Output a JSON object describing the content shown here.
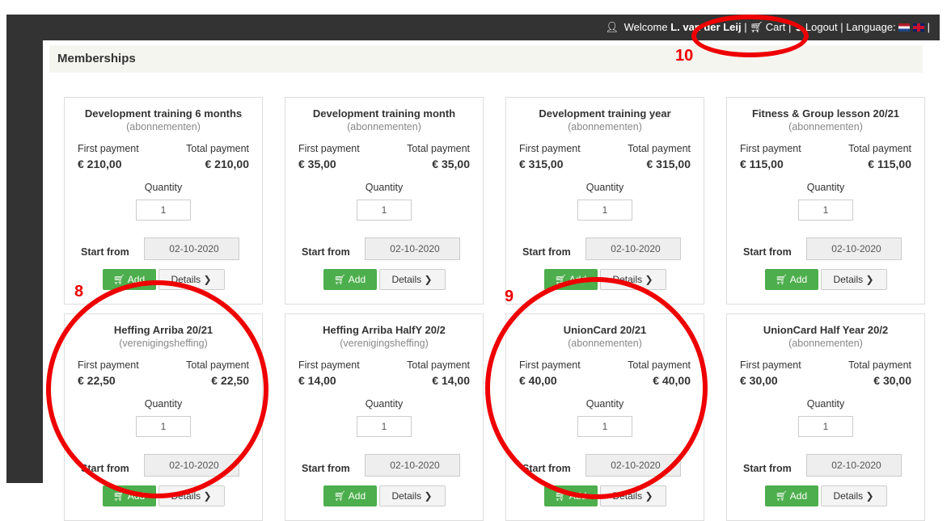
{
  "topbar": {
    "welcome": "Welcome",
    "user": "L. van der Leij",
    "sep1": "|",
    "cart": "Cart",
    "sep2": "|",
    "logout": "Logout",
    "sep3": "|",
    "language": "Language:",
    "sep4": "|"
  },
  "section": {
    "title": "Memberships"
  },
  "labels": {
    "first_payment": "First payment",
    "total_payment": "Total payment",
    "quantity": "Quantity",
    "start_from": "Start from",
    "add": "Add",
    "details": "Details"
  },
  "cards": [
    {
      "title": "Development training 6 months",
      "type": "(abonnementen)",
      "first": "€ 210,00",
      "total": "€ 210,00",
      "qty": "1",
      "start": "02-10-2020"
    },
    {
      "title": "Development training month",
      "type": "(abonnementen)",
      "first": "€ 35,00",
      "total": "€ 35,00",
      "qty": "1",
      "start": "02-10-2020"
    },
    {
      "title": "Development training year",
      "type": "(abonnementen)",
      "first": "€ 315,00",
      "total": "€ 315,00",
      "qty": "1",
      "start": "02-10-2020"
    },
    {
      "title": "Fitness & Group lesson 20/21",
      "type": "(abonnementen)",
      "first": "€ 115,00",
      "total": "€ 115,00",
      "qty": "1",
      "start": "02-10-2020"
    },
    {
      "title": "Heffing Arriba 20/21",
      "type": "(verenigingsheffing)",
      "first": "€ 22,50",
      "total": "€ 22,50",
      "qty": "1",
      "start": "02-10-2020"
    },
    {
      "title": "Heffing Arriba HalfY 20/2",
      "type": "(verenigingsheffing)",
      "first": "€ 14,00",
      "total": "€ 14,00",
      "qty": "1",
      "start": "02-10-2020"
    },
    {
      "title": "UnionCard 20/21",
      "type": "(abonnementen)",
      "first": "€ 40,00",
      "total": "€ 40,00",
      "qty": "1",
      "start": "02-10-2020"
    },
    {
      "title": "UnionCard Half Year 20/2",
      "type": "(abonnementen)",
      "first": "€ 30,00",
      "total": "€ 30,00",
      "qty": "1",
      "start": "02-10-2020"
    }
  ],
  "annotations": {
    "a8": "8",
    "a9": "9",
    "a10": "10"
  },
  "colors": {
    "add_button": "#4cae4c",
    "annotation": "#e00000",
    "header_bg": "#333333"
  },
  "icons": [
    "user-icon",
    "cart-icon",
    "logout-icon",
    "flag-nl-icon",
    "flag-uk-icon",
    "chevron-right-icon"
  ]
}
